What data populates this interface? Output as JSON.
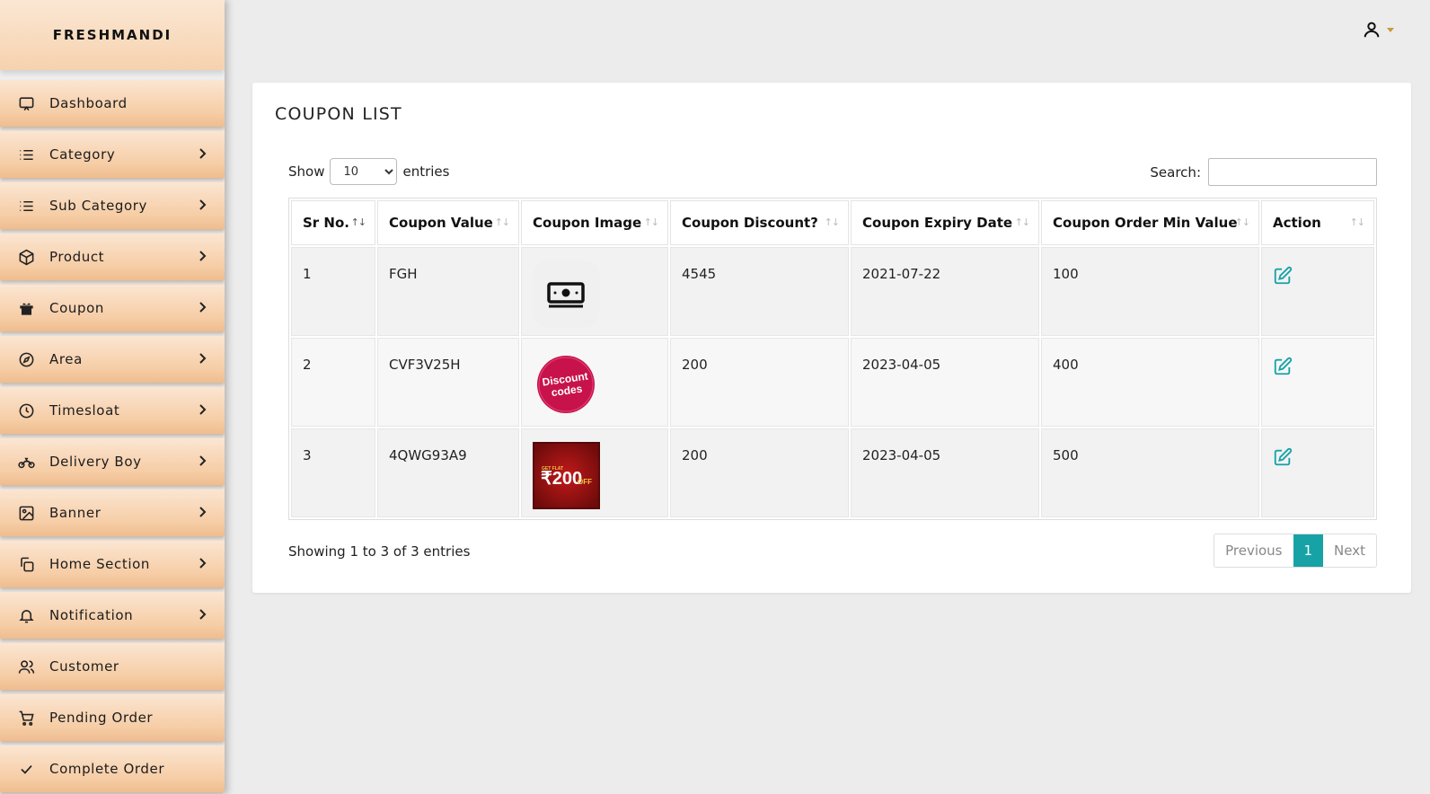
{
  "brand": "FRESHMANDI",
  "sidebar": {
    "items": [
      {
        "label": "Dashboard",
        "icon": "monitor-icon",
        "has_arrow": false
      },
      {
        "label": "Category",
        "icon": "list-icon",
        "has_arrow": true
      },
      {
        "label": "Sub Category",
        "icon": "list-icon",
        "has_arrow": true
      },
      {
        "label": "Product",
        "icon": "box-icon",
        "has_arrow": true
      },
      {
        "label": "Coupon",
        "icon": "gift-icon",
        "has_arrow": true
      },
      {
        "label": "Area",
        "icon": "compass-icon",
        "has_arrow": true
      },
      {
        "label": "Timesloat",
        "icon": "clock-icon",
        "has_arrow": true
      },
      {
        "label": "Delivery Boy",
        "icon": "motorbike-icon",
        "has_arrow": true
      },
      {
        "label": "Banner",
        "icon": "image-icon",
        "has_arrow": true
      },
      {
        "label": "Home Section",
        "icon": "copy-icon",
        "has_arrow": true
      },
      {
        "label": "Notification",
        "icon": "bell-icon",
        "has_arrow": true
      },
      {
        "label": "Customer",
        "icon": "users-icon",
        "has_arrow": false
      },
      {
        "label": "Pending Order",
        "icon": "cart-icon",
        "has_arrow": false
      },
      {
        "label": "Complete Order",
        "icon": "check-icon",
        "has_arrow": false
      }
    ]
  },
  "main": {
    "title": "COUPON LIST",
    "length": {
      "show_label": "Show",
      "selected": "10",
      "entries_label": "entries"
    },
    "search": {
      "label": "Search:",
      "value": ""
    },
    "table": {
      "headers": [
        "Sr No.",
        "Coupon Value",
        "Coupon Image",
        "Coupon Discount?",
        "Coupon Expiry Date",
        "Coupon Order Min Value",
        "Action"
      ],
      "rows": [
        {
          "sr": "1",
          "value": "FGH",
          "image": "money-image",
          "discount": "4545",
          "expiry": "2021-07-22",
          "min": "100"
        },
        {
          "sr": "2",
          "value": "CVF3V25H",
          "image": "discount-codes-image",
          "discount": "200",
          "expiry": "2023-04-05",
          "min": "400"
        },
        {
          "sr": "3",
          "value": "4QWG93A9",
          "image": "flat-200-off-image",
          "discount": "200",
          "expiry": "2023-04-05",
          "min": "500"
        }
      ]
    },
    "info": "Showing 1 to 3 of 3 entries",
    "pagination": {
      "previous": "Previous",
      "current": "1",
      "next": "Next"
    },
    "image_text": {
      "discount_line1": "Discount",
      "discount_line2": "codes",
      "flat_small": "GET FLAT",
      "flat_value": "₹200",
      "flat_off": "OFF"
    }
  },
  "colors": {
    "accent": "#17a2a6",
    "sidebar_top": "#fbe6d2",
    "sidebar_bottom": "#efbd8f"
  }
}
